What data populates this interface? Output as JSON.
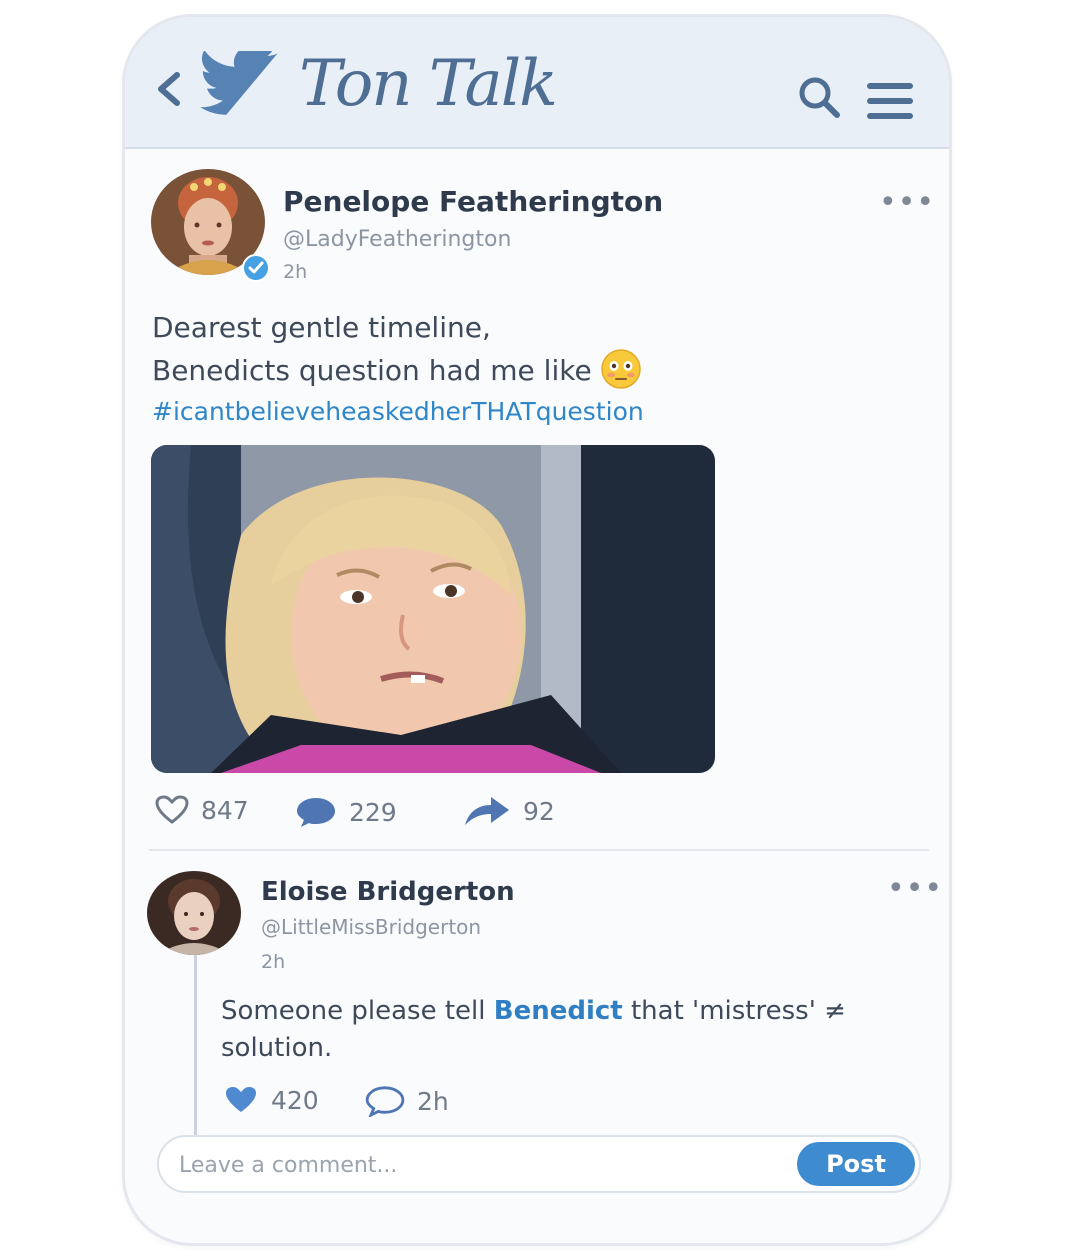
{
  "header": {
    "app_title": "Ton Talk",
    "accent_color": "#4f6e93",
    "icons": [
      "chevron-left-icon",
      "bird-logo-icon",
      "search-icon",
      "hamburger-menu-icon"
    ]
  },
  "post": {
    "author_name": "Penelope Featherington",
    "author_handle": "@LadyFeatherington",
    "time": "2h",
    "verified": true,
    "text_line1": "Dearest gentle timeline,",
    "text_line2": "Benedicts question had me like",
    "emoji": "flushed-face-icon",
    "hashtag": "#icantbelieveheaskedherTHATquestion",
    "stats": {
      "likes": "847",
      "comments": "229",
      "shares": "92"
    }
  },
  "reply": {
    "author_name": "Eloise Bridgerton",
    "author_handle": "@LittleMissBridgerton",
    "time": "2h",
    "text_before": "Someone please tell ",
    "mention": "Benedict",
    "text_after": " that 'mistress' ≠ solution.",
    "stats": {
      "likes": "420",
      "time": "2h"
    }
  },
  "comment": {
    "placeholder": "Leave a comment...",
    "button_label": "Post",
    "button_color": "#3f8bd0"
  }
}
